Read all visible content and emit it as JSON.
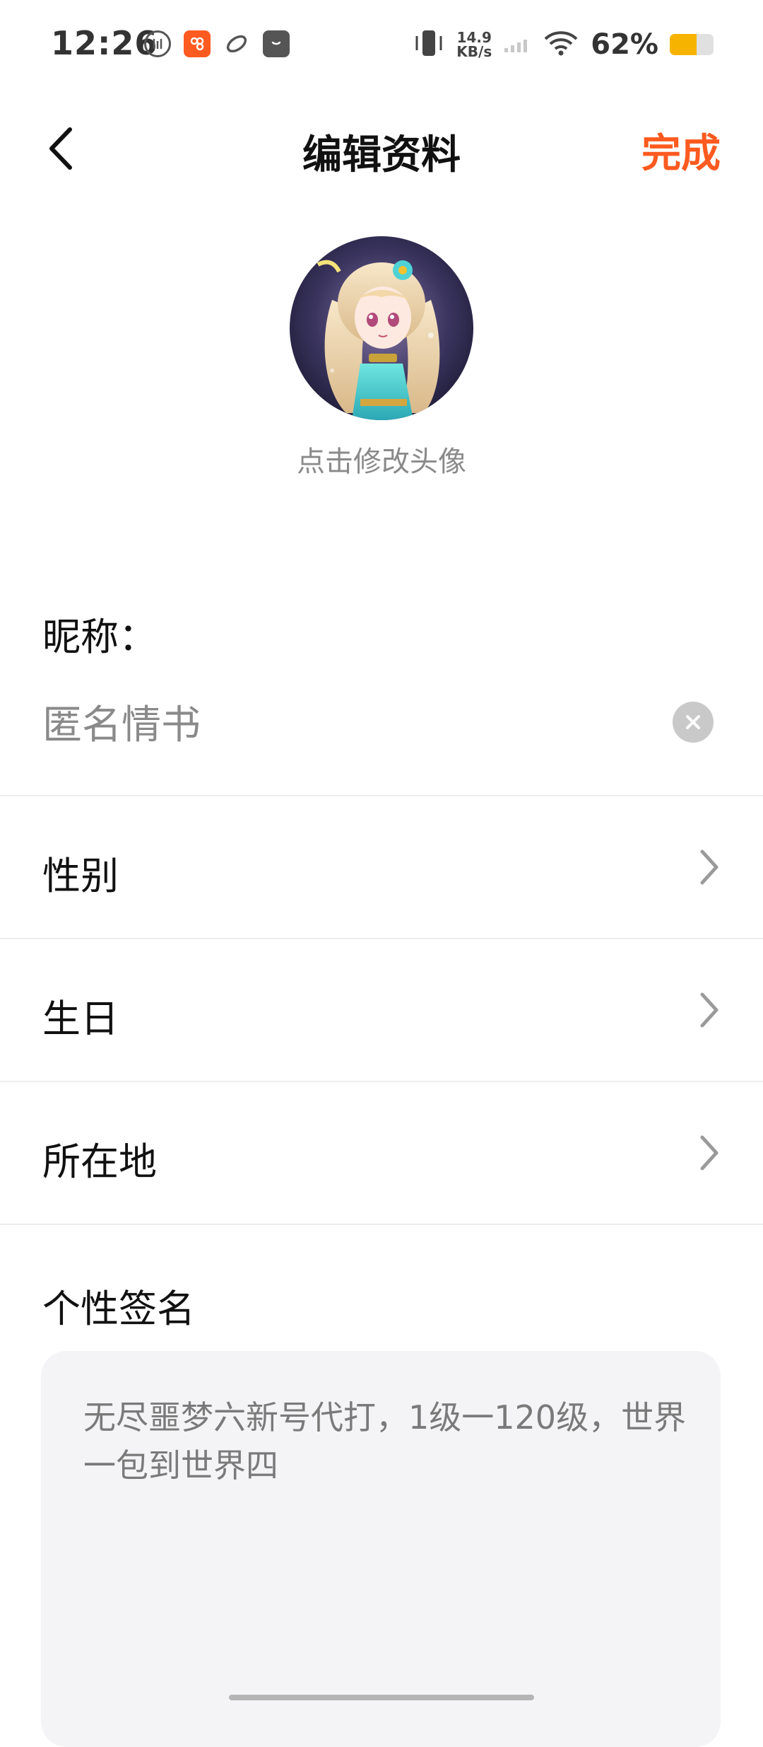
{
  "status": {
    "time": "12:26",
    "net_speed_value": "14.9",
    "net_speed_unit": "KB/s",
    "battery_pct": "62%",
    "battery_level": 0.62
  },
  "header": {
    "title": "编辑资料",
    "done_label": "完成"
  },
  "avatar": {
    "hint": "点击修改头像"
  },
  "nickname": {
    "label": "昵称：",
    "value": "匿名情书"
  },
  "rows": [
    {
      "label": "性别"
    },
    {
      "label": "生日"
    },
    {
      "label": "所在地"
    }
  ],
  "signature": {
    "label": "个性签名",
    "text": "无尽噩梦六新号代打，1级一120级，世界一包到世界四"
  },
  "colors": {
    "accent": "#ff5a1f",
    "battery": "#f6b400"
  }
}
